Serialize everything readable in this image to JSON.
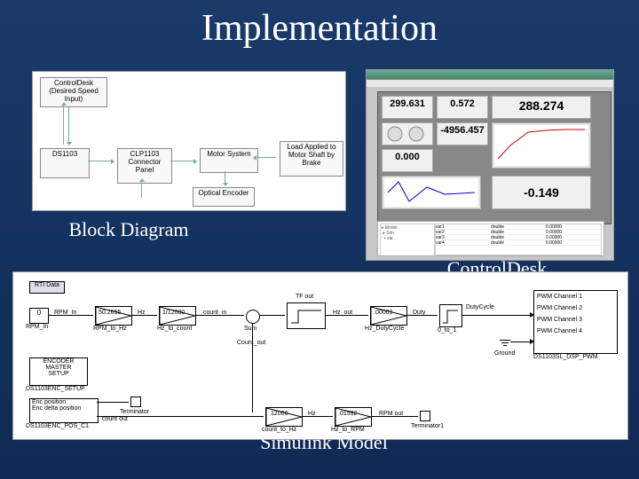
{
  "title": "Implementation",
  "captions": {
    "block": "Block Diagram",
    "controldesk": "ControlDesk",
    "simulink": "Simulink Model"
  },
  "block_diagram": {
    "ctrl": "ControlDesk\n(Desired Speed\nInput)",
    "ds": "DS1103",
    "conn": "CLP1103\nConnector\nPanel",
    "motor": "Motor System",
    "load": "Load Applied to\nMotor Shaft\nby Brake",
    "enc": "Optical Encoder"
  },
  "controldesk": {
    "inst": [
      {
        "val": "299.631"
      },
      {
        "val": "0.572"
      },
      {
        "val": "288.274"
      },
      {
        "val": "0.000"
      },
      {
        "val": "-4956.457"
      },
      {
        "val": "-0.149"
      }
    ]
  },
  "simulink": {
    "const0": "0",
    "rpm_in": "RPM_In",
    "rpm_in2": "RPM_In",
    "gain1": "50.2655",
    "rpm2hz": "RPM_to_Hz",
    "gain2": "1/12000",
    "hz2cnt": "Hz_to_count",
    "cnt_in": "count_in",
    "cnt_out": "Count_out",
    "sum": "Sum",
    "tf_blk": "TF out",
    "tf_lbl": "Hz_out",
    "gain3": ".00003",
    "hz2duty": "Hz_DutyCycle",
    "duty_lbl": "Duty",
    "sat_lbl": "DutyCycle",
    "zero_one": "0_to_1",
    "pwm1": "PWM Channel 1",
    "pwm2": "PWM Channel 2",
    "pwm3": "PWM Channel 3",
    "pwm4": "PWM Channel 4",
    "pwm_blk": "DS1103SL_DSP_PWM",
    "ground": "Ground",
    "enc_setup": "ENCODER\nMASTER\nSETUP",
    "enc_setup2": "DS1103ENC_SETUP",
    "enc_pos": "Enc position",
    "enc_delta": "Enc delta position",
    "enc_blk": "DS1103ENC_POS_C1",
    "term": "Terminator",
    "term2": "Terminator1",
    "cnt_out2": "count out",
    "g12000": "12000",
    "cnt2hz": "count_to_Hz",
    "g01592": ".01592",
    "hz2rpm": "Hz_to_RPM",
    "rpm_out": "RPM out",
    "hz_lbl": "Hz",
    "rticfg": "RTI Data"
  }
}
